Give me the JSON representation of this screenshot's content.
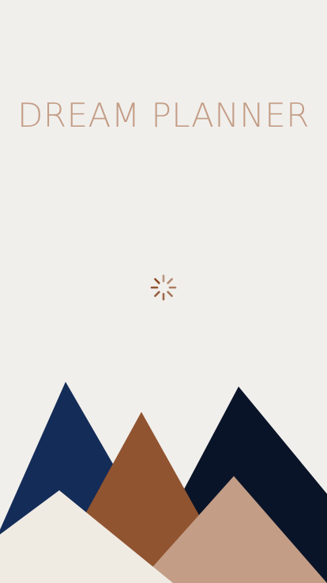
{
  "screen": {
    "title": "DREAM PLANNER",
    "background_color": "#f1efec",
    "title_color": "#c39d86",
    "status": "loading"
  },
  "spinner": {
    "icon": "loading-spinner-icon",
    "color": "#8c4a25"
  },
  "illustration": {
    "icon": "mountains-illustration",
    "colors": {
      "navy": "#142c58",
      "dark_navy": "#0a1428",
      "rust": "#915430",
      "tan": "#c39d86",
      "cream": "#efebe3"
    }
  }
}
